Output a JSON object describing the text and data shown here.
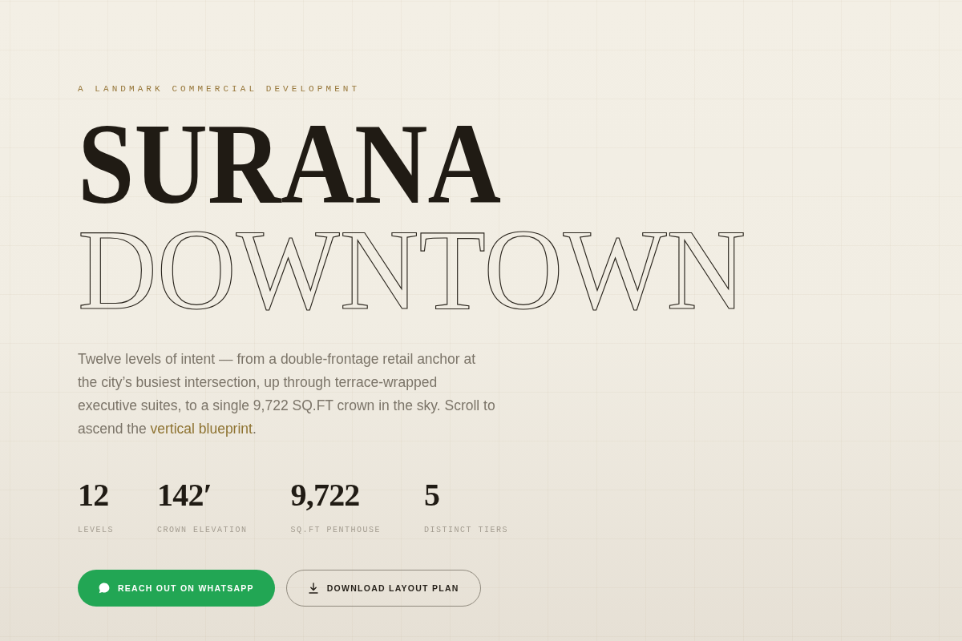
{
  "eyebrow": "A LANDMARK COMMERCIAL DEVELOPMENT",
  "title_lines": [
    {
      "text": "SURANA",
      "kind": "solid"
    },
    {
      "text": "DOWNTOWN",
      "kind": "outline"
    }
  ],
  "intro": {
    "before": "Twelve levels of intent — from a double-frontage retail anchor at the city’s busiest intersection, up through terrace-wrapped executive suites, to a single 9,722 SQ.FT crown in the sky. Scroll to ascend the",
    "link": "vertical blueprint",
    "after": "."
  },
  "stats": [
    {
      "value": "12",
      "label": "LEVELS"
    },
    {
      "value": "142′",
      "label": "CROWN ELEVATION"
    },
    {
      "value": "9,722",
      "label": "SQ.FT PENTHOUSE"
    },
    {
      "value": "5",
      "label": "DISTINCT TIERS"
    }
  ],
  "buttons": [
    {
      "label": "REACH OUT ON WHATSAPP",
      "kind": "primary"
    },
    {
      "label": "DOWNLOAD LAYOUT PLAN",
      "kind": "outline"
    }
  ]
}
